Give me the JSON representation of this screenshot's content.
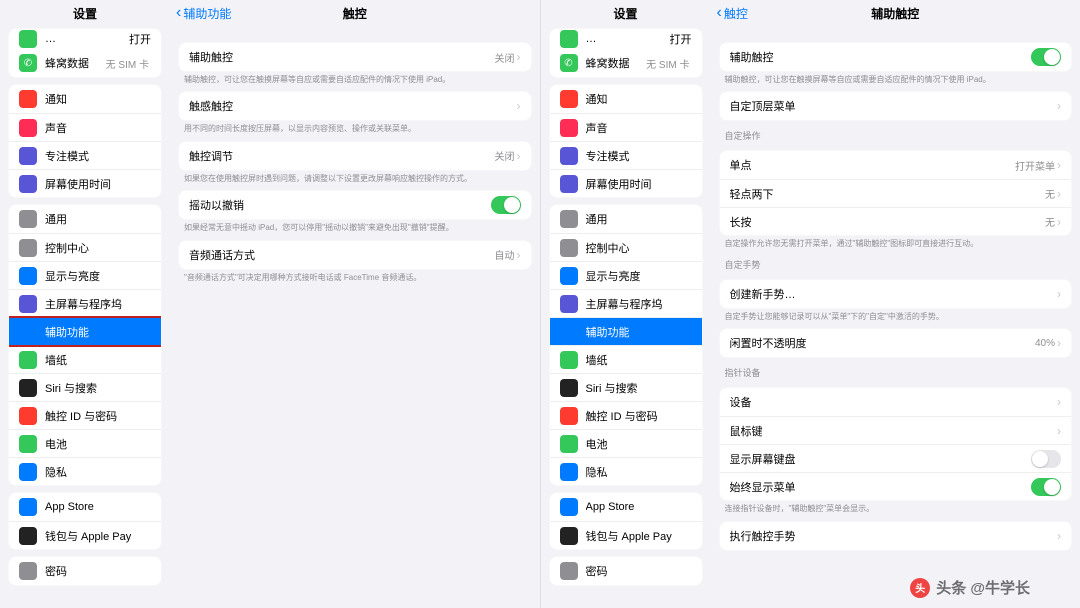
{
  "left": {
    "sidebar": {
      "title": "设置",
      "top_partial": {
        "l1": "蜂窝数据",
        "v1": "无 SIM 卡"
      },
      "g1": [
        {
          "icon": "#ff3b30",
          "label": "通知"
        },
        {
          "icon": "#ff2d55",
          "label": "声音"
        },
        {
          "icon": "#5856d6",
          "label": "专注模式"
        },
        {
          "icon": "#5856d6",
          "label": "屏幕使用时间"
        }
      ],
      "g2": [
        {
          "icon": "#8e8e93",
          "label": "通用"
        },
        {
          "icon": "#8e8e93",
          "label": "控制中心"
        },
        {
          "icon": "#007aff",
          "label": "显示与亮度"
        },
        {
          "icon": "#5856d6",
          "label": "主屏幕与程序坞"
        },
        {
          "icon": "#007aff",
          "label": "辅助功能",
          "selected": true
        },
        {
          "icon": "#34c759",
          "label": "墙纸"
        },
        {
          "icon": "#222",
          "label": "Siri 与搜索"
        },
        {
          "icon": "#ff3b30",
          "label": "触控 ID 与密码"
        },
        {
          "icon": "#34c759",
          "label": "电池"
        },
        {
          "icon": "#007aff",
          "label": "隐私"
        }
      ],
      "g3": [
        {
          "icon": "#007aff",
          "label": "App Store"
        },
        {
          "icon": "#222",
          "label": "钱包与 Apple Pay"
        }
      ],
      "g4": [
        {
          "icon": "#8e8e93",
          "label": "密码"
        }
      ]
    },
    "detail": {
      "back": "辅助功能",
      "title": "触控",
      "rows": {
        "assistive": {
          "label": "辅助触控",
          "val": "关闭"
        },
        "assistive_note": "辅助触控，可让您在触摸屏幕等自应或需要自适应配件的情况下使用 iPad。",
        "haptic": {
          "label": "触感触控"
        },
        "haptic_note": "用不同的时间长度按压屏幕，以显示内容预览、操作或关联菜单。",
        "adjust": {
          "label": "触控调节",
          "val": "关闭"
        },
        "adjust_note": "如果您在使用触控屏时遇到问题，请调整以下设置更改屏幕响应触控操作的方式。",
        "shake": {
          "label": "摇动以撤销",
          "on": true
        },
        "shake_note": "如果经常无意中摇动 iPad，您可以停用\"摇动以撤销\"来避免出现\"撤销\"提醒。",
        "call": {
          "label": "音频通话方式",
          "val": "自动"
        },
        "call_note": "\"音频通话方式\"可决定用哪种方式接听电话或 FaceTime 音频通话。"
      }
    }
  },
  "right": {
    "sidebar": {
      "title": "设置",
      "top_partial": {
        "l1": "蜂窝数据",
        "v1": "无 SIM 卡"
      },
      "g1": [
        {
          "icon": "#ff3b30",
          "label": "通知"
        },
        {
          "icon": "#ff2d55",
          "label": "声音"
        },
        {
          "icon": "#5856d6",
          "label": "专注模式"
        },
        {
          "icon": "#5856d6",
          "label": "屏幕使用时间"
        }
      ],
      "g2": [
        {
          "icon": "#8e8e93",
          "label": "通用"
        },
        {
          "icon": "#8e8e93",
          "label": "控制中心"
        },
        {
          "icon": "#007aff",
          "label": "显示与亮度"
        },
        {
          "icon": "#5856d6",
          "label": "主屏幕与程序坞"
        },
        {
          "icon": "#007aff",
          "label": "辅助功能",
          "selected": true
        },
        {
          "icon": "#34c759",
          "label": "墙纸"
        },
        {
          "icon": "#222",
          "label": "Siri 与搜索"
        },
        {
          "icon": "#ff3b30",
          "label": "触控 ID 与密码"
        },
        {
          "icon": "#34c759",
          "label": "电池"
        },
        {
          "icon": "#007aff",
          "label": "隐私"
        }
      ],
      "g3": [
        {
          "icon": "#007aff",
          "label": "App Store"
        },
        {
          "icon": "#222",
          "label": "钱包与 Apple Pay"
        }
      ],
      "g4": [
        {
          "icon": "#8e8e93",
          "label": "密码"
        }
      ]
    },
    "detail": {
      "back": "触控",
      "title": "辅助触控",
      "rows": {
        "assistive": {
          "label": "辅助触控",
          "on": true
        },
        "assistive_note": "辅助触控，可让您在触摸屏幕等自应或需要自适应配件的情况下使用 iPad。",
        "custom_top": {
          "label": "自定顶层菜单"
        },
        "sec_actions": "自定操作",
        "single": {
          "label": "单点",
          "val": "打开菜单"
        },
        "double": {
          "label": "轻点两下",
          "val": "无"
        },
        "long": {
          "label": "长按",
          "val": "无"
        },
        "actions_note": "自定操作允许您无需打开菜单，通过\"辅助触控\"图标即可直接进行互动。",
        "sec_gesture": "自定手势",
        "new_gesture": {
          "label": "创建新手势…"
        },
        "gesture_note": "自定手势让您能够记录可以从\"菜单\"下的\"自定\"中激活的手势。",
        "idle": {
          "label": "闲置时不透明度",
          "val": "40%"
        },
        "sec_pointer": "指针设备",
        "device": {
          "label": "设备"
        },
        "mousekeys": {
          "label": "鼠标键"
        },
        "show_kbd": {
          "label": "显示屏幕键盘",
          "on": false
        },
        "always_menu": {
          "label": "始终显示菜单",
          "on": true
        },
        "pointer_note": "连接指针设备时，\"辅助触控\"菜单会显示。",
        "perform": {
          "label": "执行触控手势"
        }
      }
    }
  },
  "watermark": "头条 @牛学长"
}
